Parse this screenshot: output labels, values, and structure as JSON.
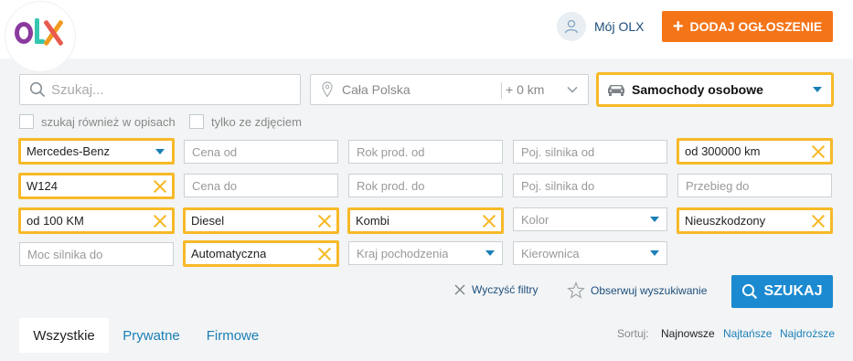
{
  "header": {
    "logo_text": "OLX",
    "account_label": "Mój OLX",
    "add_button_label": "DODAJ OGŁOSZENIE"
  },
  "search": {
    "placeholder": "Szukaj...",
    "value": "",
    "location": "Cała Polska",
    "radius": "+ 0 km",
    "category": "Samochody osobowe"
  },
  "checkboxes": {
    "descriptions": "szukaj również w opisach",
    "photos_only": "tylko ze zdjęciem"
  },
  "filters": {
    "col1": [
      "Mercedes-Benz",
      "W124",
      "od 100 KM",
      "Moc silnika do"
    ],
    "col2": [
      "Cena od",
      "Cena do",
      "Diesel",
      "Automatyczna"
    ],
    "col3": [
      "Rok prod. od",
      "Rok prod. do",
      "Kombi",
      "Kraj pochodzenia"
    ],
    "col4": [
      "Poj. silnika od",
      "Poj. silnika do",
      "Kolor",
      "Kierownica"
    ],
    "col5": [
      "od 300000 km",
      "Przebieg do",
      "Nieuszkodzony"
    ]
  },
  "actions": {
    "clear_filters": "Wyczyść filtry",
    "watch_search": "Obserwuj wyszukiwanie",
    "search_button": "SZUKAJ"
  },
  "tabs": [
    "Wszystkie",
    "Prywatne",
    "Firmowe"
  ],
  "sort": {
    "label": "Sortuj:",
    "options": [
      "Najnowsze",
      "Najtańsze",
      "Najdroższe"
    ],
    "selected": "Najnowsze"
  },
  "colors": {
    "accent_orange": "#f47418",
    "active_border": "#f7b928",
    "link_blue": "#1b7fb7",
    "search_button": "#1b8ad0",
    "panel_bg": "#f2f4f5"
  }
}
